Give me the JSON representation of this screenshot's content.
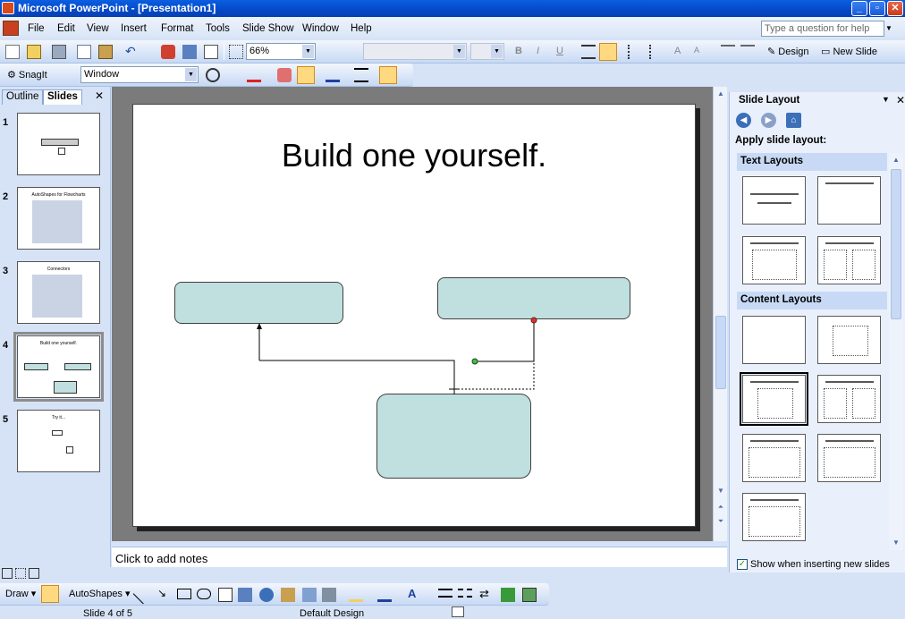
{
  "window": {
    "title": "Microsoft PowerPoint - [Presentation1]"
  },
  "menu": {
    "items": [
      "File",
      "Edit",
      "View",
      "Insert",
      "Format",
      "Tools",
      "Slide Show",
      "Window",
      "Help"
    ],
    "help_placeholder": "Type a question for help"
  },
  "toolbar": {
    "zoom": "66%",
    "design_label": "Design",
    "new_slide_label": "New Slide",
    "snagit_label": "SnagIt",
    "window_combo": "Window"
  },
  "left_pane": {
    "tabs": [
      "Outline",
      "Slides"
    ],
    "active_tab": "Slides",
    "slides": [
      {
        "number": "1",
        "title": ""
      },
      {
        "number": "2",
        "title": "AutoShapes for Flowcharts"
      },
      {
        "number": "3",
        "title": "Connectors"
      },
      {
        "number": "4",
        "title": "Build one yourself."
      },
      {
        "number": "5",
        "title": "Try it..."
      }
    ],
    "selected_slide": 4
  },
  "slide": {
    "title": "Build one yourself."
  },
  "notes": {
    "placeholder": "Click to add notes"
  },
  "task_pane": {
    "title": "Slide Layout",
    "apply_label": "Apply slide layout:",
    "text_layouts": "Text Layouts",
    "content_layouts": "Content Layouts",
    "show_checkbox": "Show when inserting new slides",
    "show_checked": true
  },
  "drawing": {
    "draw_label": "Draw",
    "autoshapes_label": "AutoShapes"
  },
  "status": {
    "slide_info": "Slide 4 of 5",
    "design": "Default Design"
  },
  "colors": {
    "accent": "#0a5fe0",
    "shape_fill": "#bfe0df",
    "toolbar_bg": "#d6e3f6"
  }
}
